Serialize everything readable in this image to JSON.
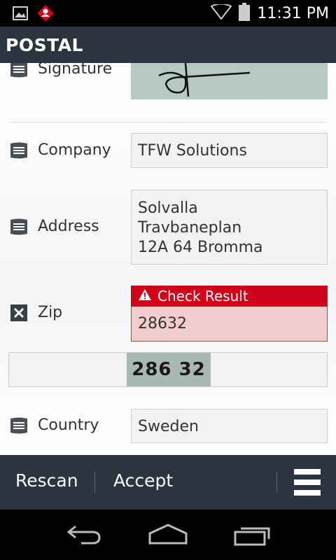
{
  "status_bar": {
    "time": "11:31 PM",
    "icons": [
      "image-notification-icon",
      "app-notification-icon",
      "wifi-icon",
      "battery-icon"
    ]
  },
  "app_bar": {
    "title": "POSTAL"
  },
  "fields": {
    "signature": {
      "label": "Signature"
    },
    "company": {
      "label": "Company",
      "value": "TFW Solutions"
    },
    "address": {
      "label": "Address",
      "value_lines": [
        "Solvalla",
        "Travbaneplan",
        "12A 64 Bromma"
      ]
    },
    "zip": {
      "label": "Zip",
      "error_message": "Check Result",
      "value": "28632",
      "scanned_snippet": "286 32"
    },
    "country": {
      "label": "Country",
      "value": "Sweden"
    }
  },
  "actions": {
    "rescan_label": "Rescan",
    "accept_label": "Accept"
  },
  "colors": {
    "app_bar": "#2a353f",
    "error": "#d0021b",
    "error_field_bg": "#f2cdcd",
    "field_bg": "#f2f2f2"
  }
}
